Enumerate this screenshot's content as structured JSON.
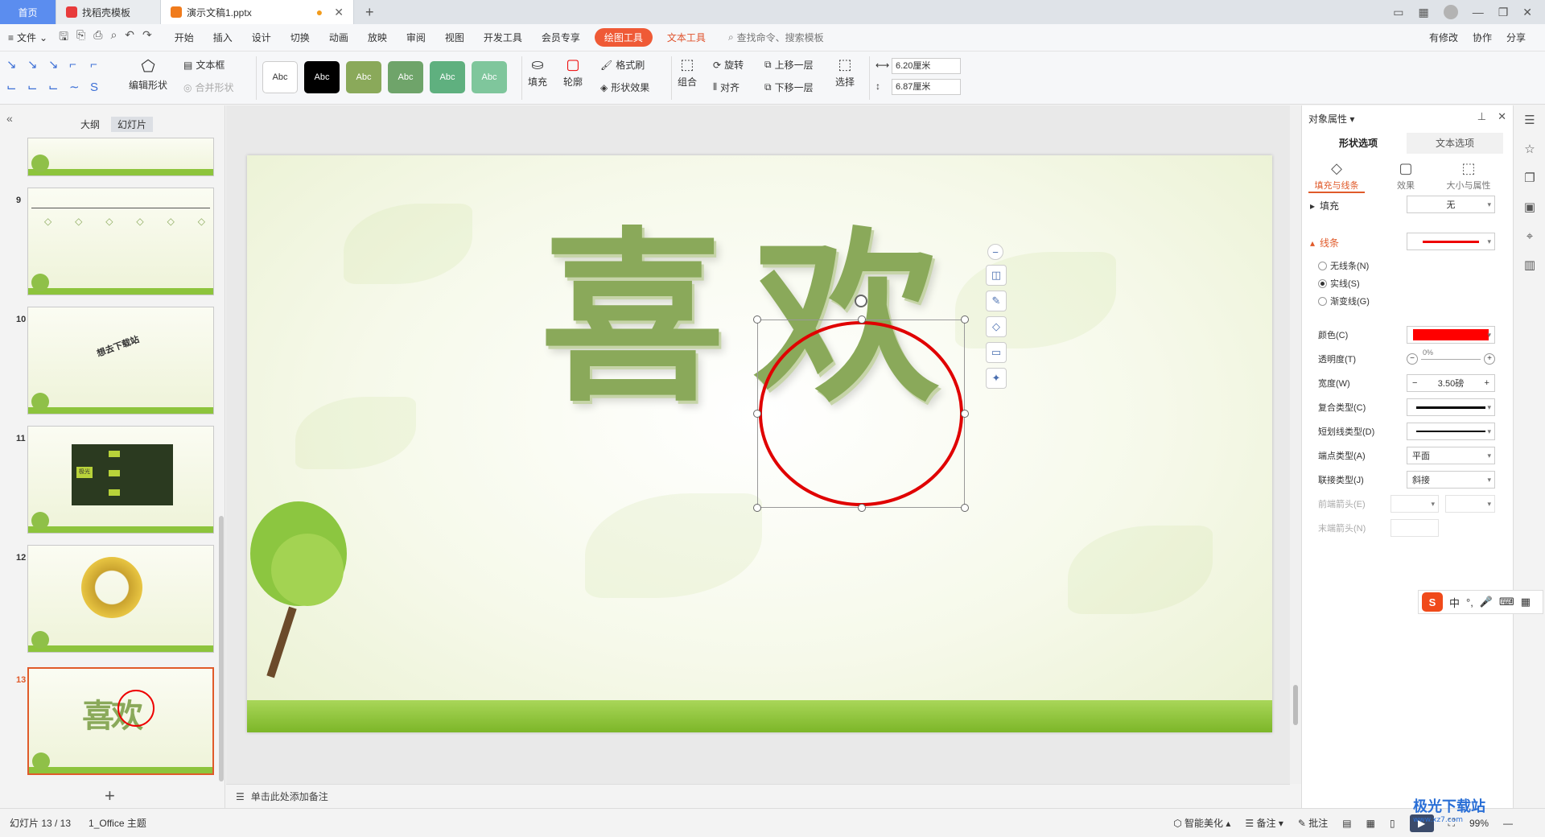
{
  "tabs": {
    "home": "首页",
    "template": "找稻壳模板",
    "doc": "演示文稿1.pptx"
  },
  "menu": {
    "file": "文件",
    "items": [
      "开始",
      "插入",
      "设计",
      "切换",
      "动画",
      "放映",
      "审阅",
      "视图",
      "开发工具",
      "会员专享"
    ],
    "drawing_tools": "绘图工具",
    "text_tools": "文本工具",
    "search": "查找命令、搜索模板",
    "right": [
      "有修改",
      "协作",
      "分享"
    ]
  },
  "ribbon": {
    "edit_shape": "编辑形状",
    "textbox": "文本框",
    "merge_shape": "合并形状",
    "style_samples": [
      "Abc",
      "Abc",
      "Abc",
      "Abc",
      "Abc",
      "Abc"
    ],
    "fill": "填充",
    "outline": "轮廓",
    "format_painter": "格式刷",
    "shape_effect": "形状效果",
    "group": "组合",
    "rotate": "旋转",
    "align": "对齐",
    "bring_forward": "上移一层",
    "send_backward": "下移一层",
    "select": "选择",
    "height": "6.20厘米",
    "width": "6.87厘米"
  },
  "left_panel": {
    "outline_tab": "大纲",
    "slides_tab": "幻灯片",
    "slide_numbers": [
      "9",
      "10",
      "11",
      "12",
      "13"
    ],
    "slide10_text": "想去下载站",
    "slide11_center": "极光"
  },
  "slide": {
    "char1": "喜",
    "char2": "欢"
  },
  "notes": {
    "placeholder": "单击此处添加备注"
  },
  "right_panel": {
    "title": "对象属性",
    "tab_shape": "形状选项",
    "tab_text": "文本选项",
    "sub_fill_line": "填充与线条",
    "sub_effect": "效果",
    "sub_size": "大小与属性",
    "fill_label": "填充",
    "fill_value": "无",
    "line_label": "线条",
    "no_line": "无线条(N)",
    "solid_line": "实线(S)",
    "gradient_line": "渐变线(G)",
    "color_label": "颜色(C)",
    "transparency_label": "透明度(T)",
    "transparency_value": "0%",
    "width_label": "宽度(W)",
    "width_value": "3.50磅",
    "compound_label": "复合类型(C)",
    "dash_label": "短划线类型(D)",
    "cap_label": "端点类型(A)",
    "cap_value": "平面",
    "join_label": "联接类型(J)",
    "join_value": "斜接",
    "begin_arrow_label": "前端箭头(E)",
    "end_arrow_label": "末端箭头(N)",
    "line_color": "#ff0000"
  },
  "statusbar": {
    "slide_info": "幻灯片 13 / 13",
    "theme": "1_Office 主题",
    "beautify": "智能美化",
    "notes": "备注",
    "comment": "批注",
    "zoom": "99%"
  },
  "ime": {
    "s": "S",
    "mode": "中"
  },
  "watermark": {
    "name": "极光下载站",
    "url": "www.xz7.com"
  }
}
